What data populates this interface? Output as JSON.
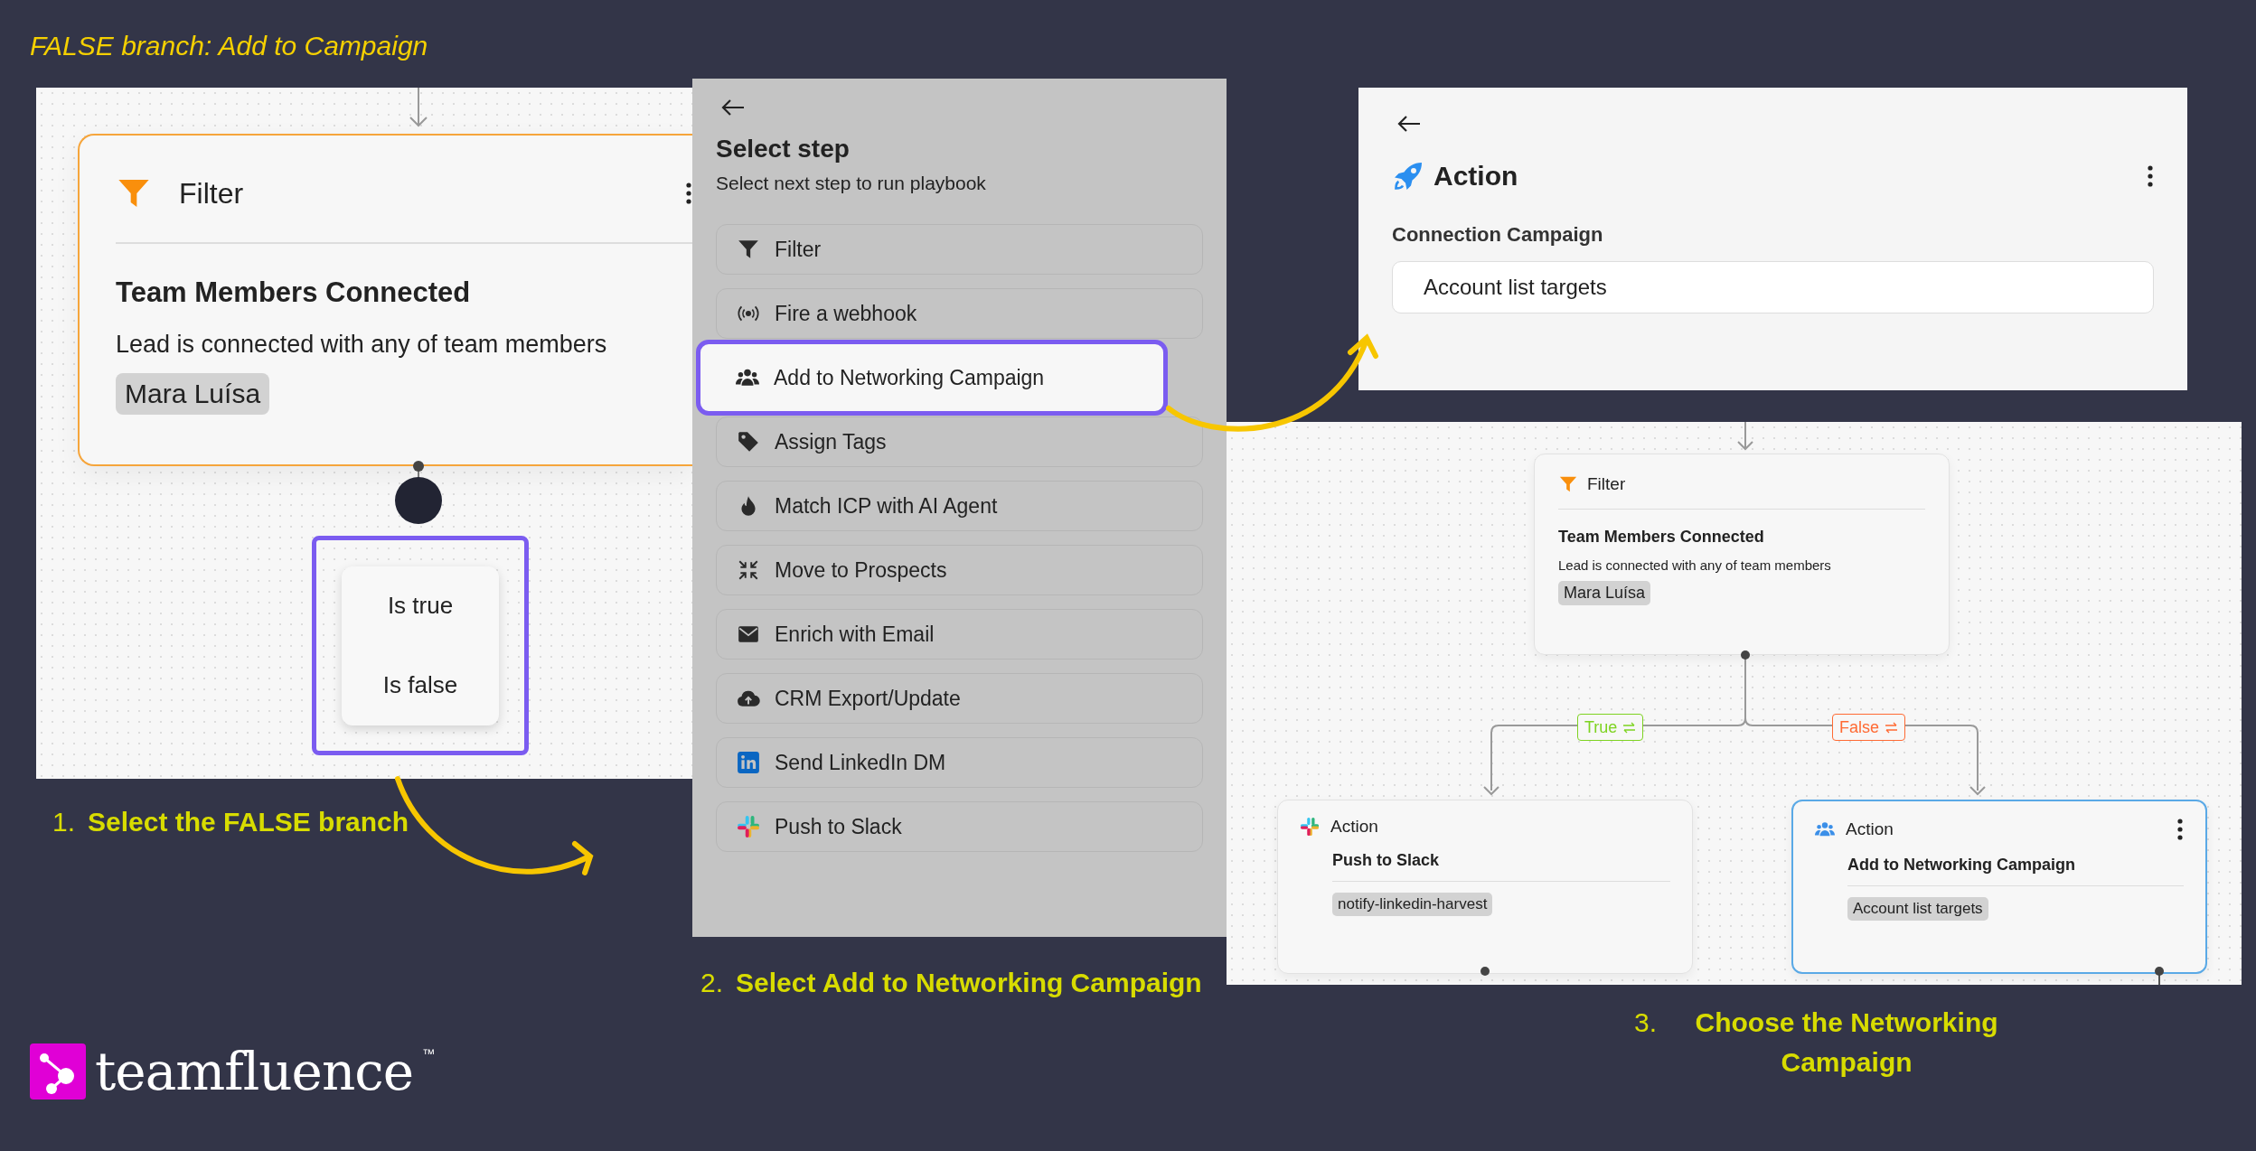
{
  "heading": "FALSE branch: Add to Campaign",
  "branch_canvas": {
    "filter_node": {
      "type": "Filter",
      "title": "Team Members Connected",
      "description": "Lead is connected with any of team members",
      "tag": "Mara Luísa"
    },
    "branch_menu": [
      "Is true",
      "Is false"
    ]
  },
  "select_step": {
    "title": "Select step",
    "subtitle": "Select next step to run playbook",
    "items": [
      {
        "label": "Filter",
        "kind": "filter",
        "selected": false
      },
      {
        "label": "Fire a webhook",
        "kind": "webhook",
        "selected": false
      },
      {
        "label": "Add to Networking Campaign",
        "kind": "people",
        "selected": true
      },
      {
        "label": "Assign Tags",
        "kind": "tag",
        "selected": false
      },
      {
        "label": "Match ICP with AI Agent",
        "kind": "fire",
        "selected": false
      },
      {
        "label": "Move to Prospects",
        "kind": "compress",
        "selected": false
      },
      {
        "label": "Enrich with Email",
        "kind": "email",
        "selected": false
      },
      {
        "label": "CRM Export/Update",
        "kind": "cloud",
        "selected": false
      },
      {
        "label": "Send LinkedIn DM",
        "kind": "linkedin",
        "selected": false
      },
      {
        "label": "Push to Slack",
        "kind": "slack",
        "selected": false
      }
    ]
  },
  "action_panel": {
    "title": "Action",
    "field_label": "Connection Campaign",
    "value": "Account list targets"
  },
  "flow": {
    "filter_node": {
      "type": "Filter",
      "title": "Team Members Connected",
      "description": "Lead is connected with any of team members",
      "tag": "Mara Luísa"
    },
    "branches": [
      {
        "label": "True",
        "color": "#7ed321"
      },
      {
        "label": "False",
        "color": "#ff6a33"
      }
    ],
    "actions": [
      {
        "kind": "slack",
        "type": "Action",
        "name": "Push to Slack",
        "tag": "notify-linkedin-harvest",
        "selected": false
      },
      {
        "kind": "people",
        "type": "Action",
        "name": "Add to Networking Campaign",
        "tag": "Account list targets",
        "selected": true
      }
    ]
  },
  "steps": [
    {
      "number": "1.",
      "text": "Select the FALSE branch"
    },
    {
      "number": "2.",
      "text": "Select Add to Networking Campaign"
    },
    {
      "number": "3.",
      "text": "Choose the Networking Campaign"
    }
  ],
  "logo": {
    "name": "team**fluence**",
    "mark": "™"
  }
}
